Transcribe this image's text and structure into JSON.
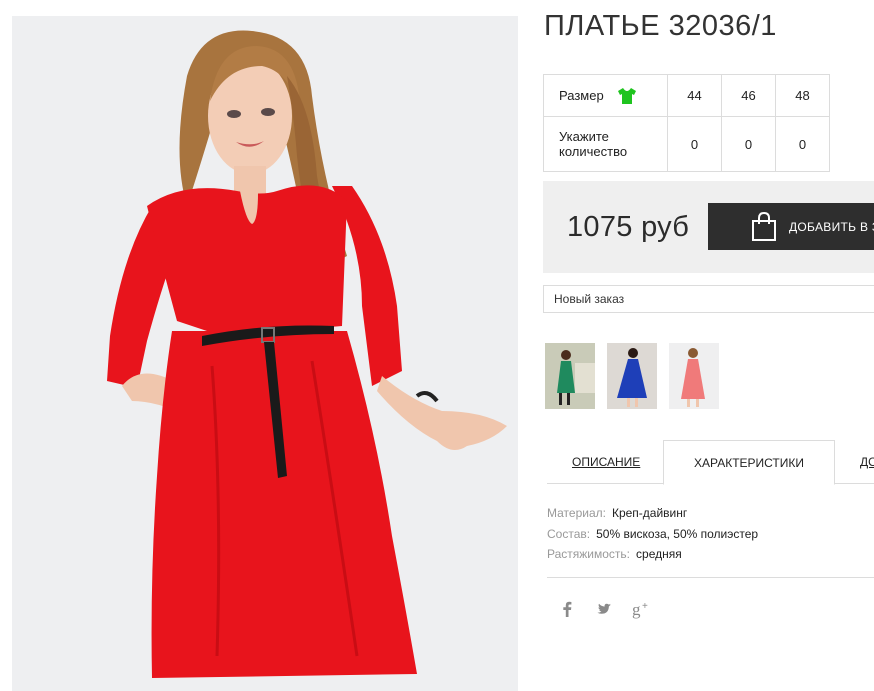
{
  "product": {
    "title": "ПЛАТЬЕ 32036/1",
    "image_alt": "Девушка в красном платье"
  },
  "size_table": {
    "size_label": "Размер",
    "size_icon": "tshirt-icon",
    "sizes": [
      "44",
      "46",
      "48"
    ],
    "qty_label_line1": "Укажите",
    "qty_label_line2": "количество",
    "quantities": [
      "0",
      "0",
      "0"
    ]
  },
  "price_block": {
    "price": "1075 руб",
    "add_button_label": "ДОБАВИТЬ В З",
    "add_button_icon": "shopping-bag-icon"
  },
  "order_select": {
    "value": "Новый заказ"
  },
  "thumbnails": [
    {
      "name": "green-dress",
      "color": "#1f8a5e"
    },
    {
      "name": "blue-dress",
      "color": "#1e3fb8"
    },
    {
      "name": "pink-dress",
      "color": "#f07a7a"
    }
  ],
  "tabs": [
    {
      "label": "ОПИСАНИЕ",
      "active": false
    },
    {
      "label": "ХАРАКТЕРИСТИКИ",
      "active": true
    },
    {
      "label": "ДО",
      "active": false
    }
  ],
  "characteristics": [
    {
      "key": "Материал:",
      "value": "Креп-дайвинг"
    },
    {
      "key": "Состав:",
      "value": "50% вискоза, 50% полиэстер"
    },
    {
      "key": "Растяжимость:",
      "value": "средняя"
    }
  ],
  "social": [
    "facebook-icon",
    "twitter-icon",
    "google-plus-icon"
  ],
  "colors": {
    "dress": "#e8141c",
    "accent_green": "#1fc41f",
    "button_dark": "#2e2e2e"
  }
}
